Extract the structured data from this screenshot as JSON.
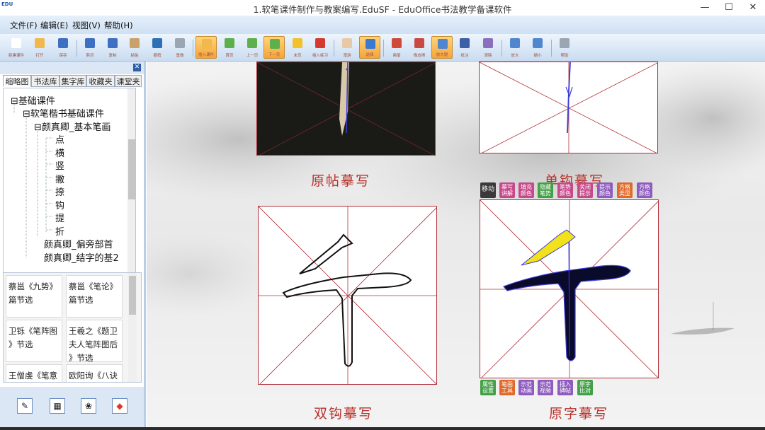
{
  "window": {
    "title": "1.软笔课件制作与教案编写.EduSF - EduOffice书法教学备课软件",
    "logo": "EDU",
    "controls": {
      "minimize": "—",
      "maximize": "☐",
      "close": "✕"
    }
  },
  "menu": {
    "items": [
      "文件(F)",
      "编辑(E)",
      "视图(V)",
      "帮助(H)"
    ]
  },
  "toolbar": {
    "buttons": [
      {
        "label": "新建课件",
        "color": "#ffffff"
      },
      {
        "label": "打开",
        "color": "#f1b94b"
      },
      {
        "label": "保存",
        "color": "#3d6fc2"
      },
      {
        "label": "剪切",
        "color": "#3d6fc2"
      },
      {
        "label": "复制",
        "color": "#3d6fc2"
      },
      {
        "label": "粘贴",
        "color": "#c9a16a"
      },
      {
        "label": "撤销",
        "color": "#2f6fb7"
      },
      {
        "label": "重做",
        "color": "#9aa6b4"
      },
      {
        "label": "插入课件",
        "color": "#f1b94b"
      },
      {
        "label": "首页",
        "color": "#5db04b"
      },
      {
        "label": "上一页",
        "color": "#5db04b"
      },
      {
        "label": "下一页",
        "color": "#5db04b"
      },
      {
        "label": "末页",
        "color": "#f2c12e"
      },
      {
        "label": "插入练习",
        "color": "#d63a2f"
      },
      {
        "label": "漫游",
        "color": "#e8c9a7"
      },
      {
        "label": "选择",
        "color": "#3a7ad1"
      },
      {
        "label": "画笔",
        "color": "#d04a3a"
      },
      {
        "label": "橡皮擦",
        "color": "#c94a40"
      },
      {
        "label": "放大镜",
        "color": "#4f86cf"
      },
      {
        "label": "批注",
        "color": "#3c5fa8"
      },
      {
        "label": "清除",
        "color": "#8b6fbf"
      },
      {
        "label": "放大",
        "color": "#4f86cf"
      },
      {
        "label": "缩小",
        "color": "#4f86cf"
      },
      {
        "label": "帮助",
        "color": "#9aa6b4"
      }
    ]
  },
  "sidebar": {
    "tabs": [
      "缩略图",
      "书法库",
      "集字库",
      "收藏夹",
      "课堂夹"
    ],
    "tree": [
      {
        "label": "基础课件",
        "prefix": "⊟"
      },
      {
        "label": "软笔楷书基础课件",
        "prefix": "⊟"
      },
      {
        "label": "颜真卿_基本笔画",
        "prefix": "⊟"
      },
      {
        "label": "点",
        "prefix": ""
      },
      {
        "label": "横",
        "prefix": ""
      },
      {
        "label": "竖",
        "prefix": ""
      },
      {
        "label": "撇",
        "prefix": ""
      },
      {
        "label": "捺",
        "prefix": ""
      },
      {
        "label": "钩",
        "prefix": ""
      },
      {
        "label": "提",
        "prefix": ""
      },
      {
        "label": "折",
        "prefix": ""
      },
      {
        "label": "颜真卿_偏旁部首",
        "prefix": "⊞"
      },
      {
        "label": "颜真卿_结字的基2",
        "prefix": "⊞"
      }
    ],
    "cards": [
      {
        "line1": "蔡邕《九势》",
        "line2": "篇节选"
      },
      {
        "line1": "蔡邕《笔论》",
        "line2": "篇节选"
      },
      {
        "line1": "卫铄《笔阵图",
        "line2": "》节选"
      },
      {
        "line1": "王羲之《题卫",
        "line2": "夫人笔阵图后"
      },
      {
        "line1": "王僧虔《笔意",
        "line2": ""
      },
      {
        "line1": "欧阳询《八诀",
        "line2": ""
      }
    ],
    "card_extra": "》节选"
  },
  "canvas": {
    "captions": [
      "原帖摹写",
      "单钩摹写",
      "双钩摹写",
      "原字摹写"
    ],
    "top_buttons": [
      {
        "label": "移动",
        "color": "#3a3a3a"
      },
      {
        "label": "摹写讲解",
        "color": "#c64a8a"
      },
      {
        "label": "填充颜色",
        "color": "#c64a8a"
      },
      {
        "label": "隐藏笔势",
        "color": "#43a047"
      },
      {
        "label": "笔势颜色",
        "color": "#c64a8a"
      },
      {
        "label": "关闭提示",
        "color": "#c64a8a"
      },
      {
        "label": "提示颜色",
        "color": "#8e5bbf"
      },
      {
        "label": "方格类型",
        "color": "#e06a2a"
      },
      {
        "label": "方格颜色",
        "color": "#8e5bbf"
      }
    ],
    "bottom_buttons": [
      {
        "label": "属性设置",
        "color": "#43a047"
      },
      {
        "label": "笔画工具",
        "color": "#e06a2a"
      },
      {
        "label": "示范动画",
        "color": "#8e5bbf"
      },
      {
        "label": "示范视频",
        "color": "#8e5bbf"
      },
      {
        "label": "插入碑帖",
        "color": "#8e5bbf"
      },
      {
        "label": "原字比对",
        "color": "#43a047"
      }
    ]
  }
}
